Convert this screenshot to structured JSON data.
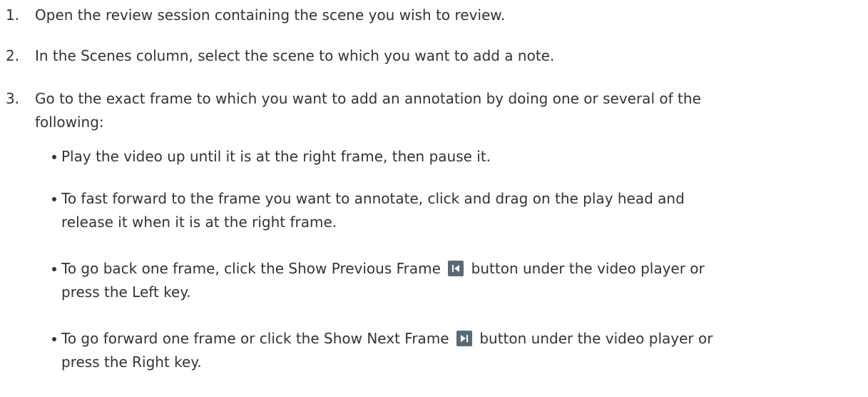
{
  "steps": [
    {
      "num": "1.",
      "text": "Open the review session containing the scene you wish to review."
    },
    {
      "num": "2.",
      "text": "In the Scenes column, select the scene to which you want to add a note."
    },
    {
      "num": "3.",
      "text_line1": "Go to the exact frame to which you want to add an annotation by doing one or several of the",
      "text_line2": "following:"
    }
  ],
  "bullets": [
    {
      "text": "Play the video up until it is at the right frame, then pause it."
    },
    {
      "line1": "To fast forward to the frame you want to annotate, click and drag on the play head and",
      "line2": "release it when it is at the right frame."
    },
    {
      "pre": "To go back one frame, click the  Show Previous Frame",
      "post": "button under the video player or",
      "line2": "press the Left key.",
      "icon": "show-previous-frame-icon"
    },
    {
      "pre": "To go forward one frame or click the  Show Next Frame",
      "post": "button under the video player or",
      "line2": "press the Right key.",
      "icon": "show-next-frame-icon"
    }
  ],
  "colors": {
    "text": "#333333",
    "icon_bg": "#5a6a75",
    "icon_fg": "#ffffff"
  }
}
